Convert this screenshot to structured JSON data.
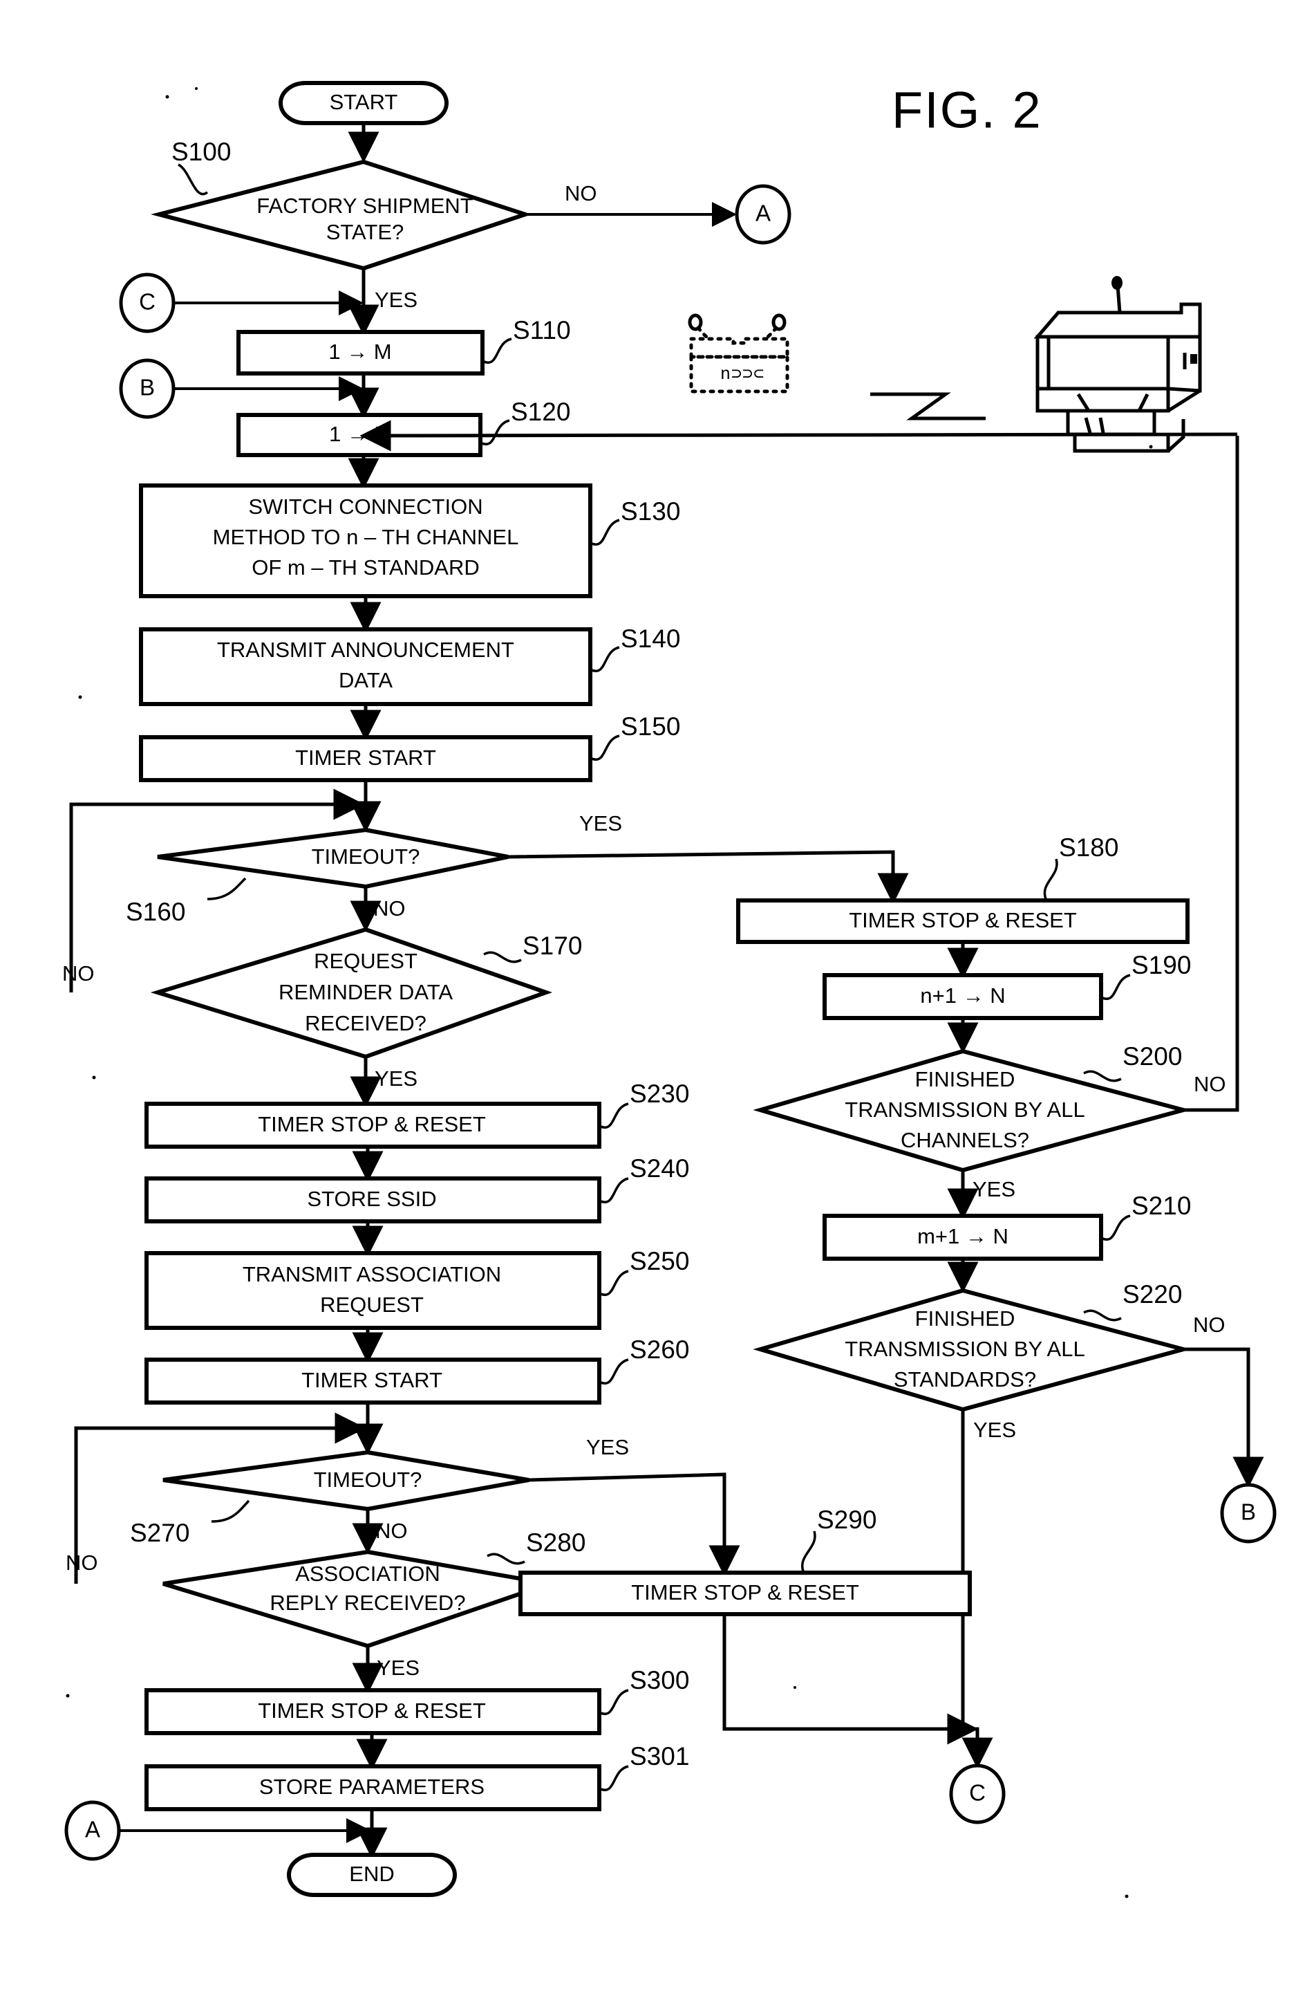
{
  "figure": {
    "title": "FIG. 2",
    "type": "patent-flowchart"
  },
  "terminals": {
    "start": "START",
    "end": "END"
  },
  "connectors": {
    "a_top": "A",
    "a_bottom": "A",
    "b_left": "B",
    "b_right": "B",
    "c_left": "C",
    "c_right": "C"
  },
  "branch_labels": {
    "yes": "YES",
    "no": "NO"
  },
  "nodes": [
    {
      "id": "S100",
      "ref": "S100",
      "shape": "decision",
      "lines": [
        "FACTORY SHIPMENT",
        "STATE?"
      ]
    },
    {
      "id": "S110",
      "ref": "S110",
      "shape": "process",
      "lines": [
        "1 → M"
      ]
    },
    {
      "id": "S120",
      "ref": "S120",
      "shape": "process",
      "lines": [
        "1 → N"
      ]
    },
    {
      "id": "S130",
      "ref": "S130",
      "shape": "process",
      "lines": [
        "SWITCH CONNECTION",
        "METHOD TO n – TH CHANNEL",
        "OF m – TH STANDARD"
      ]
    },
    {
      "id": "S140",
      "ref": "S140",
      "shape": "process",
      "lines": [
        "TRANSMIT ANNOUNCEMENT",
        "DATA"
      ]
    },
    {
      "id": "S150",
      "ref": "S150",
      "shape": "process",
      "lines": [
        "TIMER START"
      ]
    },
    {
      "id": "S160",
      "ref": "S160",
      "shape": "decision",
      "lines": [
        "TIMEOUT?"
      ]
    },
    {
      "id": "S170",
      "ref": "S170",
      "shape": "decision",
      "lines": [
        "REQUEST",
        "REMINDER DATA",
        "RECEIVED?"
      ]
    },
    {
      "id": "S180",
      "ref": "S180",
      "shape": "process",
      "lines": [
        "TIMER STOP & RESET"
      ]
    },
    {
      "id": "S190",
      "ref": "S190",
      "shape": "process",
      "lines": [
        "n+1 → N"
      ]
    },
    {
      "id": "S200",
      "ref": "S200",
      "shape": "decision",
      "lines": [
        "FINISHED",
        "TRANSMISSION BY ALL",
        "CHANNELS?"
      ]
    },
    {
      "id": "S210",
      "ref": "S210",
      "shape": "process",
      "lines": [
        "m+1 → N"
      ]
    },
    {
      "id": "S220",
      "ref": "S220",
      "shape": "decision",
      "lines": [
        "FINISHED",
        "TRANSMISSION BY ALL",
        "STANDARDS?"
      ]
    },
    {
      "id": "S230",
      "ref": "S230",
      "shape": "process",
      "lines": [
        "TIMER STOP & RESET"
      ]
    },
    {
      "id": "S240",
      "ref": "S240",
      "shape": "process",
      "lines": [
        "STORE SSID"
      ]
    },
    {
      "id": "S250",
      "ref": "S250",
      "shape": "process",
      "lines": [
        "TRANSMIT ASSOCIATION",
        "REQUEST"
      ]
    },
    {
      "id": "S260",
      "ref": "S260",
      "shape": "process",
      "lines": [
        "TIMER START"
      ]
    },
    {
      "id": "S270",
      "ref": "S270",
      "shape": "decision",
      "lines": [
        "TIMEOUT?"
      ]
    },
    {
      "id": "S280",
      "ref": "S280",
      "shape": "decision",
      "lines": [
        "ASSOCIATION",
        "REPLY RECEIVED?"
      ]
    },
    {
      "id": "S290",
      "ref": "S290",
      "shape": "process",
      "lines": [
        "TIMER STOP & RESET"
      ]
    },
    {
      "id": "S300",
      "ref": "S300",
      "shape": "process",
      "lines": [
        "TIMER STOP & RESET"
      ]
    },
    {
      "id": "S301",
      "ref": "S301",
      "shape": "process",
      "lines": [
        "STORE PARAMETERS"
      ]
    }
  ],
  "illustration": {
    "access_point_label": "n⊃⊃⊂",
    "access_point_name": "wireless-access-point",
    "printer_name": "printer",
    "link_name": "wireless-link"
  }
}
